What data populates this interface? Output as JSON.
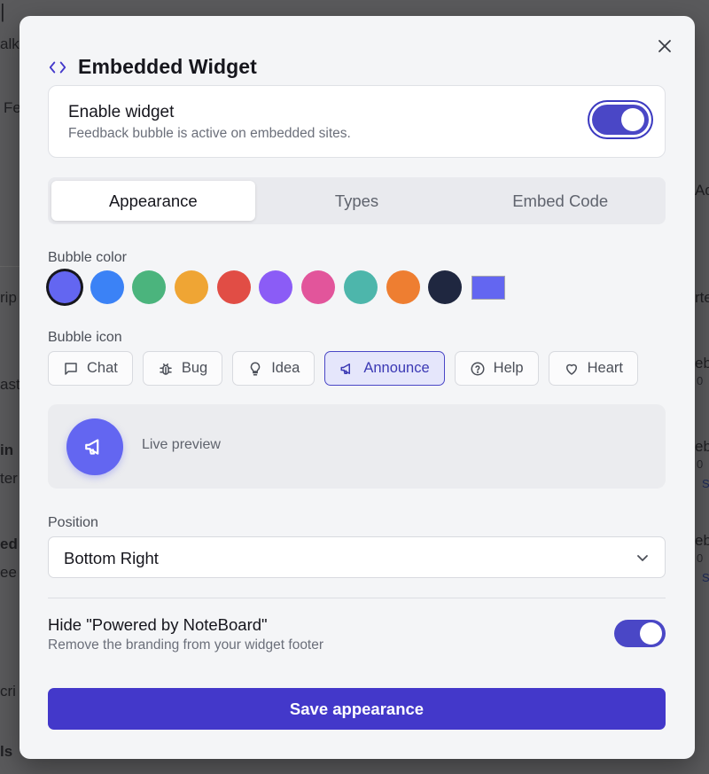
{
  "background": {
    "fragments": [
      "alk",
      "Fe",
      "rip",
      "ast",
      "in",
      "ter",
      "ed",
      "ee",
      "cri",
      "ls",
      "Ad",
      "rte",
      "eba",
      "0",
      "eba",
      "0",
      "S",
      "eba",
      "0",
      "S"
    ]
  },
  "modal": {
    "title": "Embedded Widget",
    "close_icon": "close-icon",
    "enable": {
      "title": "Enable widget",
      "subtitle": "Feedback bubble is active on embedded sites.",
      "enabled": true
    },
    "tabs": [
      {
        "label": "Appearance",
        "active": true
      },
      {
        "label": "Types",
        "active": false
      },
      {
        "label": "Embed Code",
        "active": false
      }
    ],
    "bubble_color": {
      "label": "Bubble color",
      "selected": "#6366f1",
      "swatches": [
        "#6366f1",
        "#3b82f6",
        "#4bb47d",
        "#efa534",
        "#e14d45",
        "#8b5cf6",
        "#e2559b",
        "#4db6ab",
        "#ee7e31",
        "#1f2740"
      ],
      "custom": "#6366f1"
    },
    "bubble_icon": {
      "label": "Bubble icon",
      "options": [
        {
          "label": "Chat",
          "icon": "chat-icon"
        },
        {
          "label": "Bug",
          "icon": "bug-icon"
        },
        {
          "label": "Idea",
          "icon": "lightbulb-icon"
        },
        {
          "label": "Announce",
          "icon": "megaphone-icon",
          "active": true
        },
        {
          "label": "Help",
          "icon": "help-icon"
        },
        {
          "label": "Heart",
          "icon": "heart-icon"
        }
      ]
    },
    "preview": {
      "label": "Live preview",
      "icon": "megaphone-icon"
    },
    "position": {
      "label": "Position",
      "value": "Bottom Right"
    },
    "branding": {
      "title": "Hide \"Powered by NoteBoard\"",
      "subtitle": "Remove the branding from your widget footer",
      "enabled": true
    },
    "save_label": "Save appearance",
    "accent": "#4338ca"
  }
}
